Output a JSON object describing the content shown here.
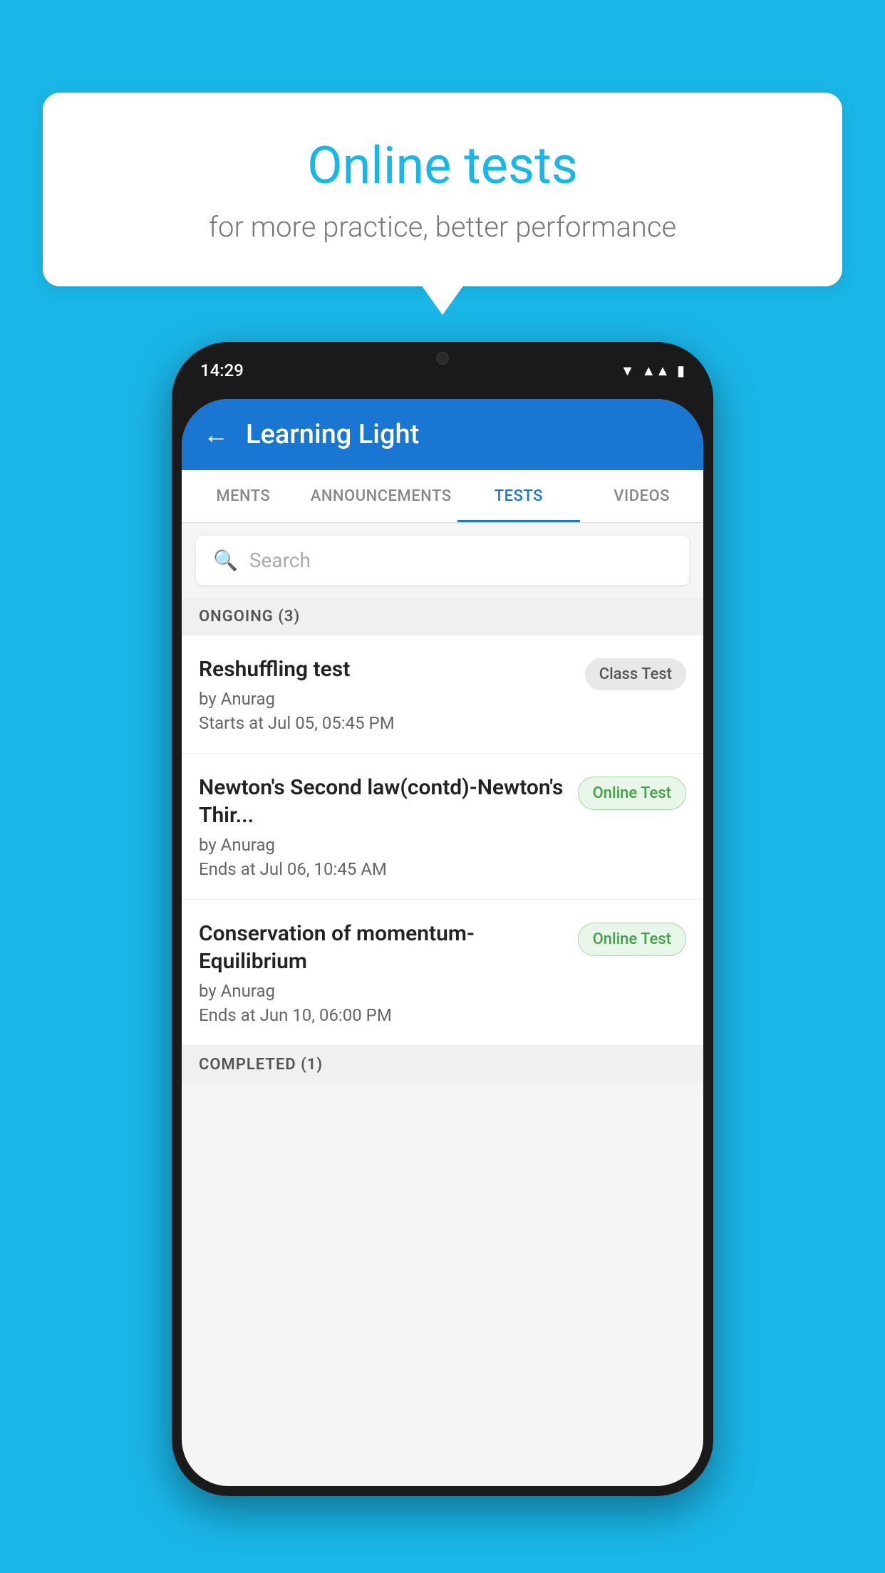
{
  "background": {
    "color": "#1ab6e8"
  },
  "speech_bubble": {
    "title": "Online tests",
    "subtitle": "for more practice, better performance"
  },
  "phone": {
    "status_bar": {
      "time": "14:29",
      "icons": [
        "wifi",
        "signal",
        "battery"
      ]
    },
    "header": {
      "title": "Learning Light",
      "back_label": "←"
    },
    "tabs": [
      {
        "label": "MENTS",
        "active": false
      },
      {
        "label": "ANNOUNCEMENTS",
        "active": false
      },
      {
        "label": "TESTS",
        "active": true
      },
      {
        "label": "VIDEOS",
        "active": false
      }
    ],
    "search": {
      "placeholder": "Search"
    },
    "sections": [
      {
        "header": "ONGOING (3)",
        "tests": [
          {
            "name": "Reshuffling test",
            "author": "by Anurag",
            "date": "Starts at  Jul 05, 05:45 PM",
            "badge": "Class Test",
            "badge_type": "class"
          },
          {
            "name": "Newton's Second law(contd)-Newton's Thir...",
            "author": "by Anurag",
            "date": "Ends at  Jul 06, 10:45 AM",
            "badge": "Online Test",
            "badge_type": "online"
          },
          {
            "name": "Conservation of momentum-Equilibrium",
            "author": "by Anurag",
            "date": "Ends at  Jun 10, 06:00 PM",
            "badge": "Online Test",
            "badge_type": "online"
          }
        ]
      },
      {
        "header": "COMPLETED (1)",
        "tests": []
      }
    ]
  }
}
